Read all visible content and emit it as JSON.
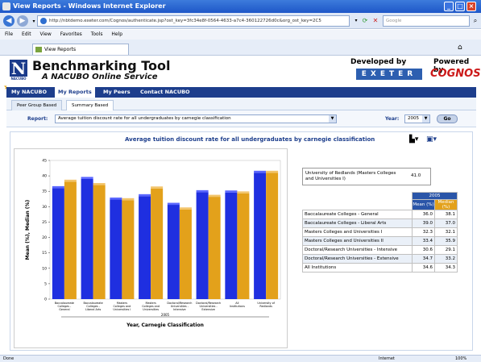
{
  "window": {
    "title": "View Reports - Windows Internet Explorer"
  },
  "browser": {
    "url": "http://nbtdemo.exeter.com/Cognos/authenticate.jsp?ost_key=3fc34e8f-0564-4633-a7c4-360122726d0c&org_ost_key=2C5",
    "search_placeholder": "Google",
    "menu": [
      "File",
      "Edit",
      "View",
      "Favorites",
      "Tools",
      "Help"
    ],
    "tab_label": "View Reports",
    "status_left": "Done",
    "status_zone": "Internet",
    "zoom": "100%"
  },
  "header": {
    "logo_letter": "N",
    "logo_sub": "NACUBO",
    "title": "Benchmarking Tool",
    "subtitle": "A NACUBO Online Service",
    "developed_by": "Developed by",
    "exeter": "EXETER",
    "powered_by": "Powered by",
    "cognos": "COGNOS"
  },
  "nav": [
    "My NACUBO",
    "My Reports",
    "My Peers",
    "Contact NACUBO"
  ],
  "subtabs": [
    "Peer Group Based",
    "Summary Based"
  ],
  "report": {
    "label": "Report:",
    "value": "Average tuition discount rate for all undergraduates by carnegie classification",
    "year_label": "Year:",
    "year": "2005",
    "go": "Go"
  },
  "chart_data": {
    "type": "bar",
    "title": "Average tuition discount rate for all undergraduates by carnegie classification",
    "xlabel": "Year, Carnegie Classification",
    "ylabel": "Mean (%), Median (%)",
    "ylim": [
      0,
      45
    ],
    "yticks": [
      0,
      5,
      10,
      15,
      20,
      25,
      30,
      35,
      40,
      45
    ],
    "group_label": "2005",
    "categories": [
      "Baccalaureate Colleges - General",
      "Baccalaureate Colleges - Liberal Arts",
      "Masters Colleges and Universities I",
      "Masters Colleges and Universities II",
      "Doctoral/Research Universities - Intensive",
      "Doctoral/Research Universities - Extensive",
      "All Institutions",
      "University of Redlands"
    ],
    "series": [
      {
        "name": "Mean (%)",
        "color": "#1f2fe0",
        "values": [
          36.0,
          39.0,
          32.3,
          33.4,
          30.6,
          34.7,
          34.6,
          41.0
        ]
      },
      {
        "name": "Median (%)",
        "color": "#e3a11b",
        "values": [
          38.1,
          37.0,
          32.1,
          35.9,
          29.1,
          33.2,
          34.3,
          41.0
        ]
      }
    ]
  },
  "info": {
    "name": "University of Redlands (Masters Colleges and Universities I)",
    "value": "41.0"
  },
  "table": {
    "year": "2005",
    "col_mean": "Mean (%)",
    "col_median": "Median (%)",
    "rows": [
      {
        "label": "Baccalaureate Colleges - General",
        "mean": "36.0",
        "median": "38.1"
      },
      {
        "label": "Baccalaureate Colleges - Liberal Arts",
        "mean": "39.0",
        "median": "37.0"
      },
      {
        "label": "Masters Colleges and Universities I",
        "mean": "32.3",
        "median": "32.1"
      },
      {
        "label": "Masters Colleges and Universities II",
        "mean": "33.4",
        "median": "35.9"
      },
      {
        "label": "Doctoral/Research Universities - Intensive",
        "mean": "30.6",
        "median": "29.1"
      },
      {
        "label": "Doctoral/Research Universities - Extensive",
        "mean": "34.7",
        "median": "33.2"
      },
      {
        "label": "All Institutions",
        "mean": "34.6",
        "median": "34.3"
      }
    ]
  }
}
